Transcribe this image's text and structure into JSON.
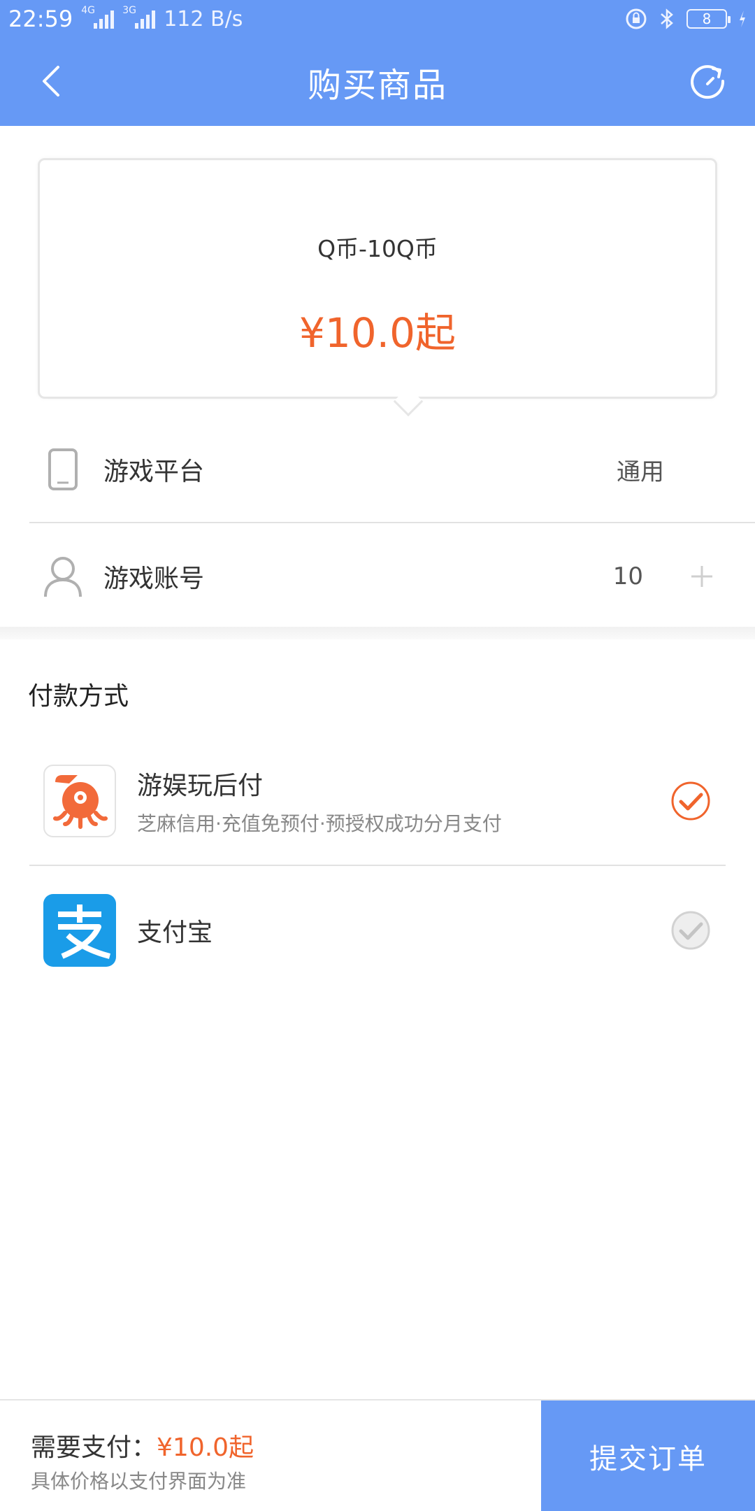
{
  "status_bar": {
    "time": "22:59",
    "signal_1_tag": "4G",
    "signal_2_tag": "3G",
    "speed": "112 B/s",
    "battery": "8"
  },
  "header": {
    "title": "购买商品",
    "bg_color": "#6699f5"
  },
  "product": {
    "name": "Q币-10Q币",
    "price": "¥10.0起"
  },
  "fields": {
    "platform_label": "游戏平台",
    "platform_value": "通用",
    "account_label": "游戏账号",
    "account_value": "10"
  },
  "payment": {
    "title": "付款方式",
    "methods": [
      {
        "name": "游娱玩后付",
        "desc": "芝麻信用·充值免预付·预授权成功分月支付",
        "selected": true
      },
      {
        "name": "支付宝",
        "desc": "",
        "selected": false
      }
    ]
  },
  "footer": {
    "need_pay_label": "需要支付：",
    "need_pay_amount": "¥10.0起",
    "note": "具体价格以支付界面为准",
    "submit_label": "提交订单"
  },
  "colors": {
    "accent": "#6699f5",
    "price": "#f0642c"
  }
}
